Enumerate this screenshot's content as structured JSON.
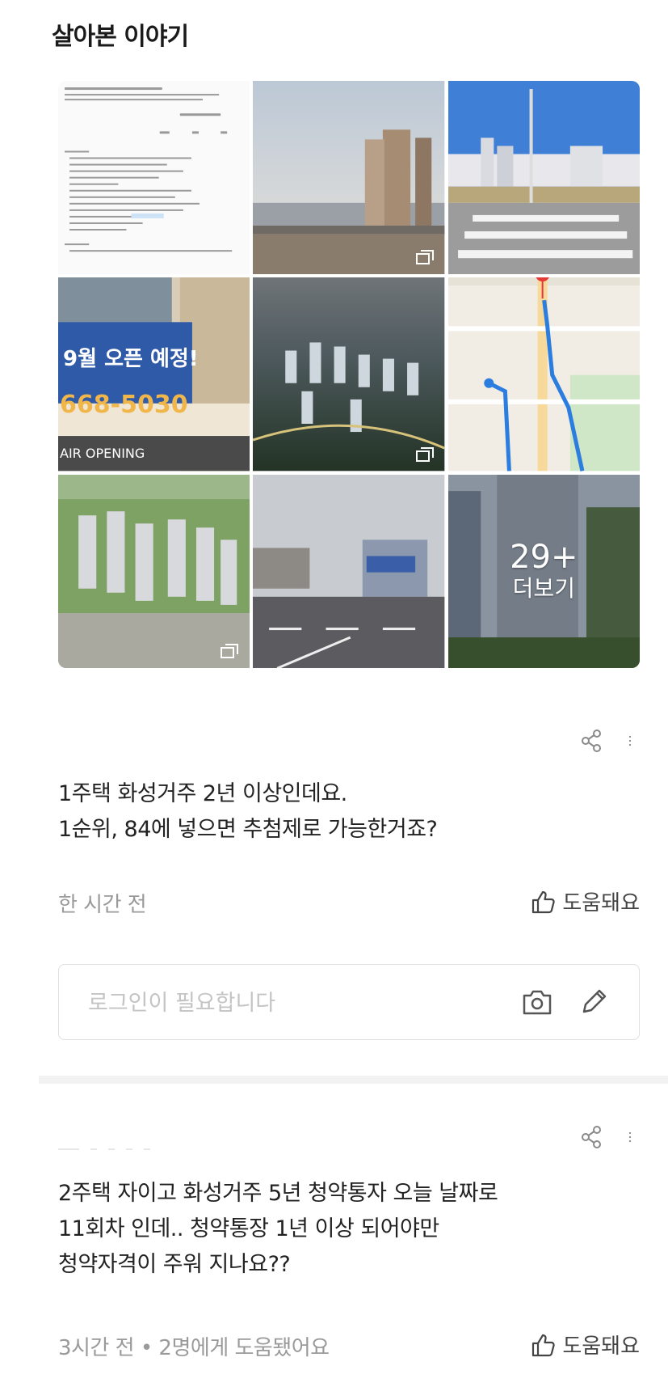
{
  "section": {
    "title": "살아본 이야기"
  },
  "gallery": {
    "images": [
      {
        "name": "document-photo"
      },
      {
        "name": "apartment-towers-photo"
      },
      {
        "name": "crosswalk-photo"
      },
      {
        "name": "banner-photo"
      },
      {
        "name": "aerial-city-photo"
      },
      {
        "name": "map-route-photo"
      },
      {
        "name": "complex-render-photo"
      },
      {
        "name": "street-photo"
      },
      {
        "name": "tower-crane-photo"
      }
    ],
    "more_count": "29+",
    "more_label": "더보기"
  },
  "posts": [
    {
      "body_lines": [
        "1주택 화성거주 2년 이상인데요.",
        "1순위, 84에 넣으면 추첨제로 가능한거죠?"
      ],
      "time": "한 시간 전",
      "helpful_label": "도움돼요"
    },
    {
      "body_lines": [
        "2주택 자이고 화성거주 5년 청약통자 오늘 날짜로",
        "11회차 인데.. 청약통장 1년 이상 되어야만",
        "청약자격이 주워 지나요??"
      ],
      "time": "3시간 전 • 2명에게 도움됐어요",
      "helpful_label": "도움돼요"
    }
  ],
  "comment": {
    "placeholder": "로그인이 필요합니다"
  },
  "colors": {
    "meta_gray": "#9a9a9a",
    "text": "#222222",
    "divider": "#f2f2f2"
  }
}
